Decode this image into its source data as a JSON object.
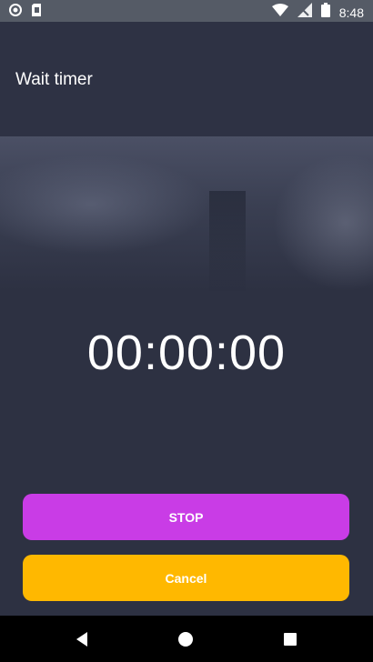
{
  "status_bar": {
    "time": "8:48",
    "icons": [
      "circle-notification-icon",
      "sim-card-icon",
      "wifi-icon",
      "no-signal-icon",
      "battery-icon"
    ]
  },
  "toolbar": {
    "title": "Wait timer"
  },
  "timer": {
    "display": "00:00:00"
  },
  "actions": {
    "stop_label": "STOP",
    "cancel_label": "Cancel"
  },
  "colors": {
    "background": "#2d3142",
    "stop_button": "#c93ce6",
    "cancel_button": "#ffb800",
    "status_bar": "#555b66",
    "nav_bar": "#000000"
  },
  "nav_bar": {
    "icons": [
      "back-icon",
      "home-icon",
      "recents-icon"
    ]
  }
}
